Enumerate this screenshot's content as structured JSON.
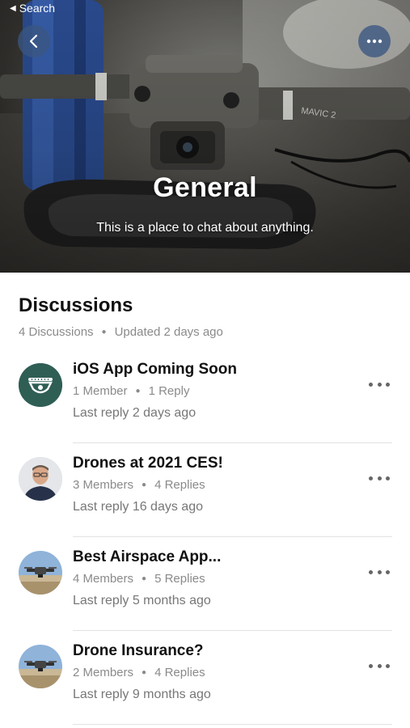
{
  "status_bar": {
    "back_label": "Search"
  },
  "hero": {
    "title": "General",
    "subtitle": "This is a place to chat about anything."
  },
  "discussions": {
    "title": "Discussions",
    "count": "4 Discussions",
    "updated": "Updated 2 days ago",
    "items": [
      {
        "title": "iOS App Coming Soon",
        "members": "1 Member",
        "replies": "1 Reply",
        "last": "Last reply 2 days ago",
        "avatar": "drone-logo-avatar"
      },
      {
        "title": "Drones at 2021 CES!",
        "members": "3 Members",
        "replies": "4 Replies",
        "last": "Last reply 16 days ago",
        "avatar": "user-photo-avatar"
      },
      {
        "title": "Best Airspace App...",
        "members": "4 Members",
        "replies": "5 Replies",
        "last": "Last reply 5 months ago",
        "avatar": "drone-photo-avatar"
      },
      {
        "title": "Drone Insurance?",
        "members": "2 Members",
        "replies": "4 Replies",
        "last": "Last reply 9 months ago",
        "avatar": "drone-photo-avatar"
      }
    ]
  },
  "colors": {
    "accent": "#3a5682",
    "logo_green": "#2f5e55",
    "muted": "#8a8a8a"
  }
}
